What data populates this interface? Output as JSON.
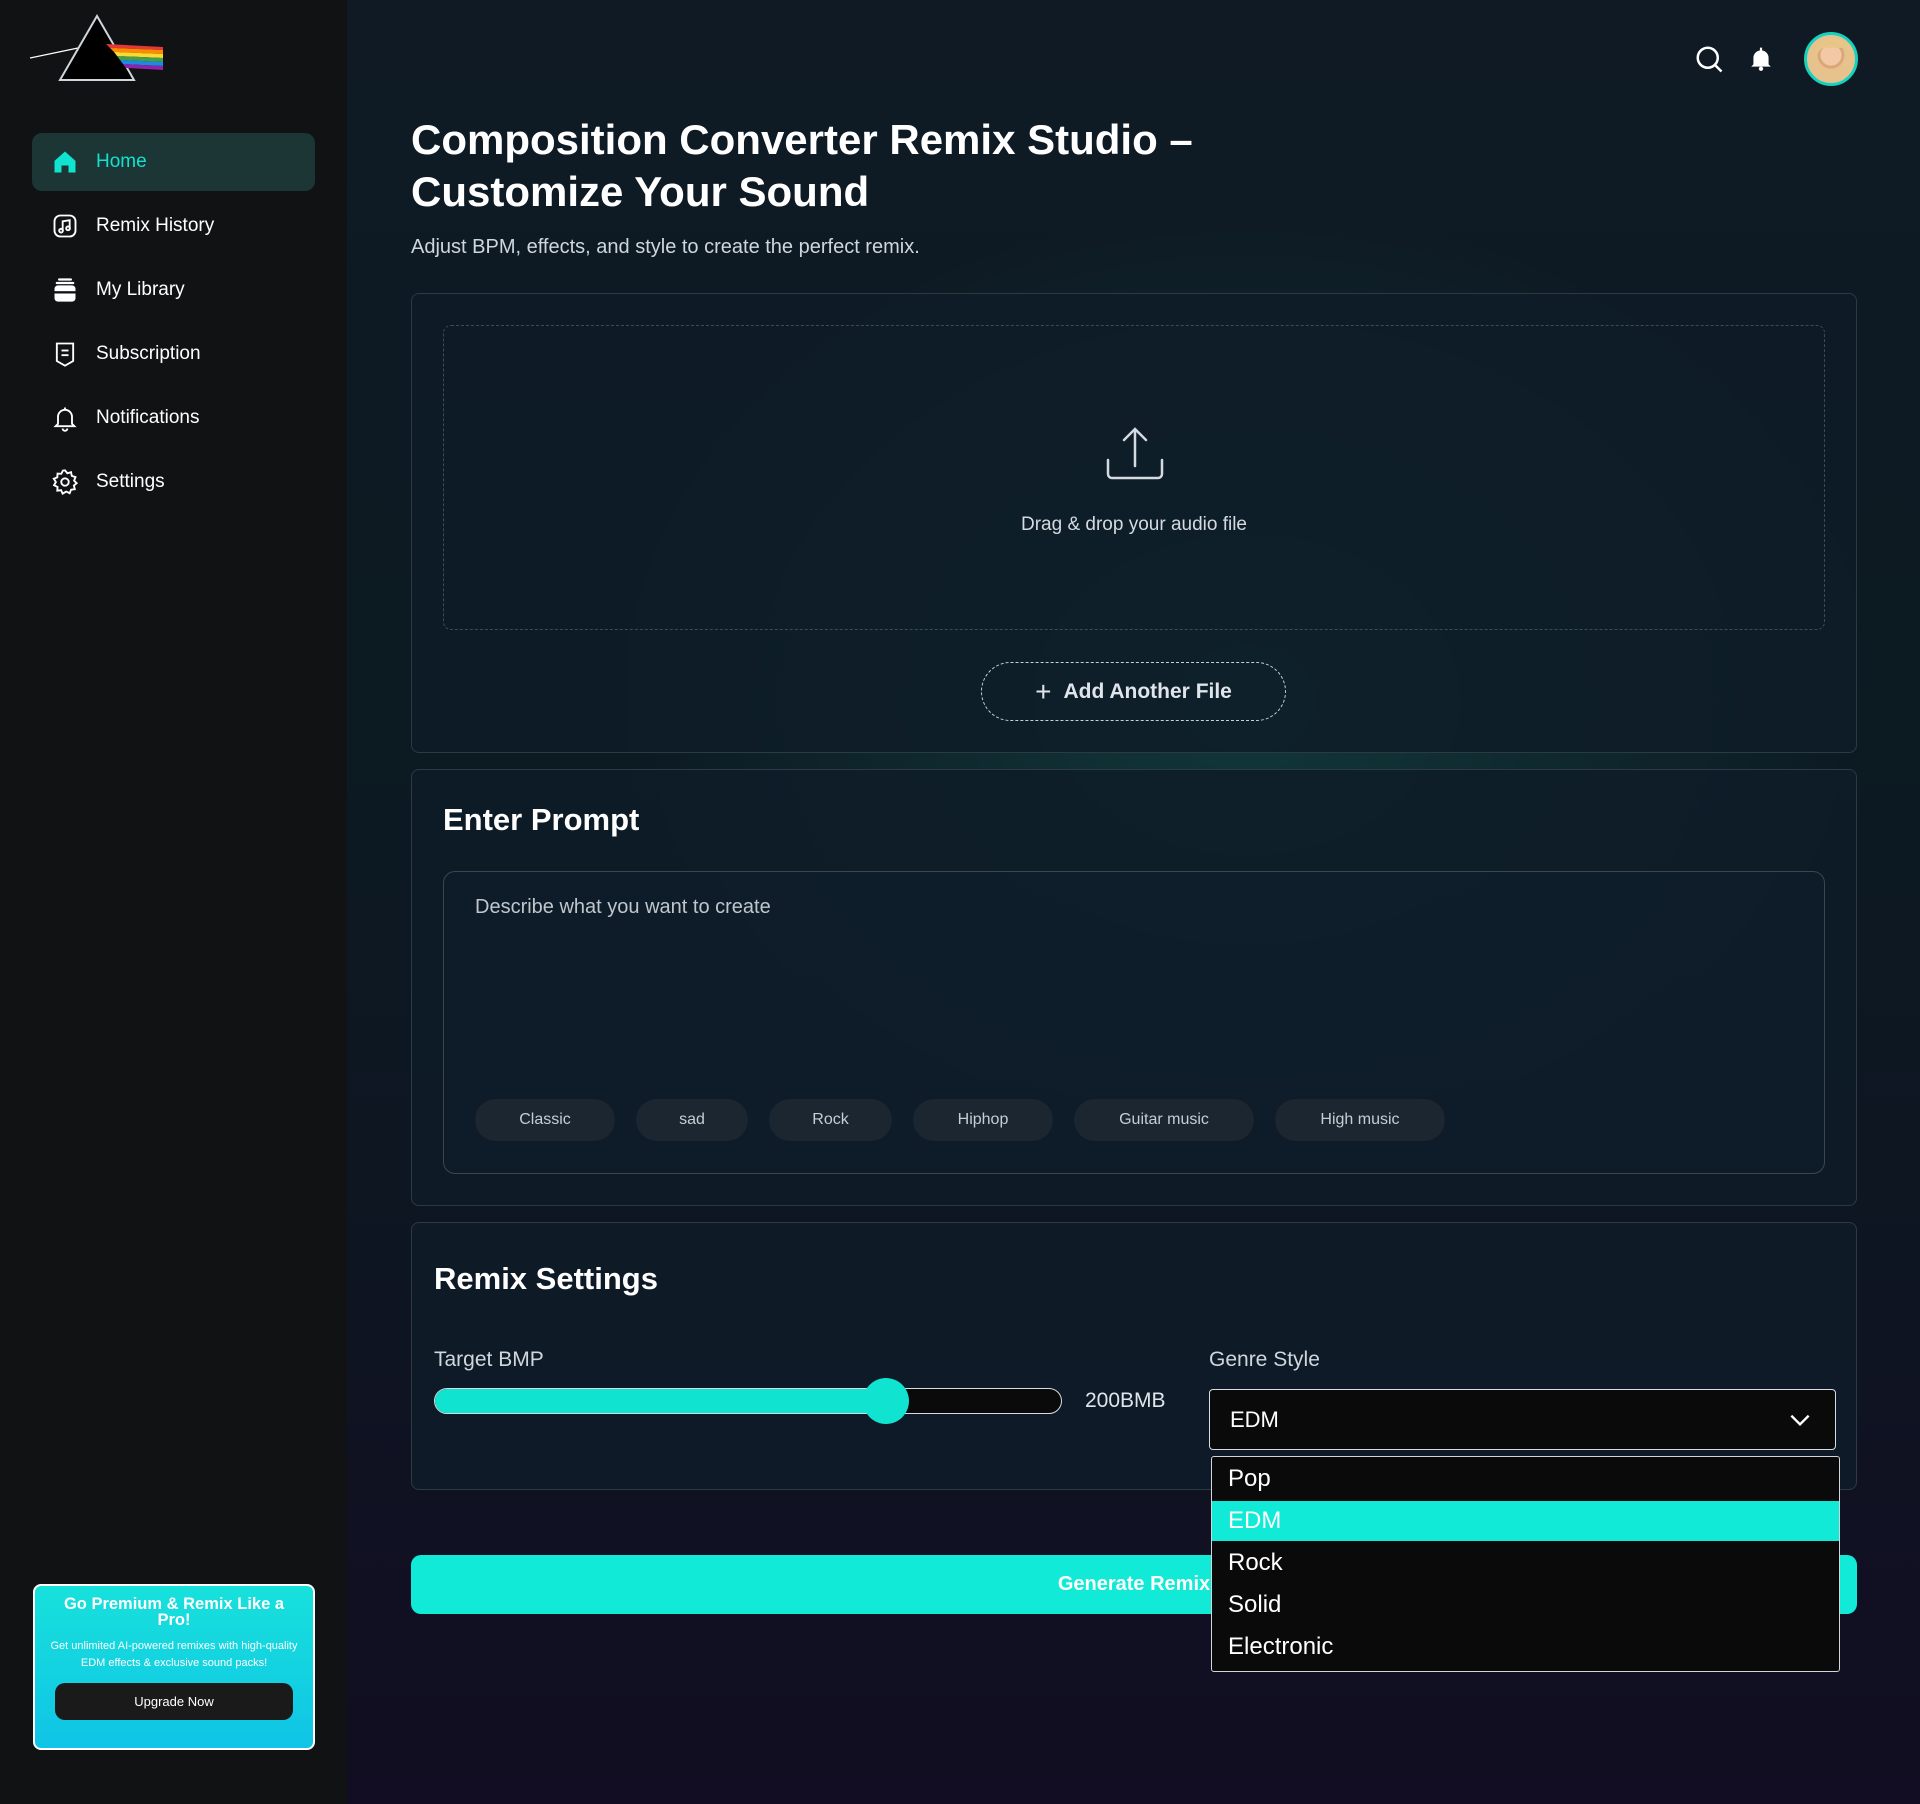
{
  "sidebar": {
    "nav": [
      {
        "label": "Home",
        "icon": "home-icon",
        "active": true
      },
      {
        "label": "Remix History",
        "icon": "music-note-icon",
        "active": false
      },
      {
        "label": "My Library",
        "icon": "library-icon",
        "active": false
      },
      {
        "label": "Subscription",
        "icon": "receipt-icon",
        "active": false
      },
      {
        "label": "Notifications",
        "icon": "bell-icon",
        "active": false
      },
      {
        "label": "Settings",
        "icon": "gear-icon",
        "active": false
      }
    ],
    "promo": {
      "title": "Go Premium & Remix Like a Pro!",
      "text": "Get unlimited AI-powered remixes with high-quality EDM effects & exclusive sound packs!",
      "button": "Upgrade Now"
    }
  },
  "header": {
    "title": "Composition Converter Remix Studio – Customize Your Sound",
    "subtitle": "Adjust BPM, effects, and style to create the perfect remix."
  },
  "upload": {
    "drop_text": "Drag & drop your audio file",
    "add_file_label": "Add Another File"
  },
  "prompt": {
    "title": "Enter Prompt",
    "placeholder": "Describe what you want to create",
    "chips": [
      "Classic",
      "sad",
      "Rock",
      "Hiphop",
      "Guitar music",
      "High music"
    ]
  },
  "settings": {
    "title": "Remix Settings",
    "bpm_label": "Target BMP",
    "bpm_value": "200BMB",
    "bpm_fill_fraction": 0.72,
    "genre_label": "Genre Style",
    "genre_selected": "EDM",
    "genre_options": [
      "Pop",
      "EDM",
      "Rock",
      "Solid",
      "Electronic"
    ]
  },
  "generate_label": "Generate Remix",
  "colors": {
    "accent": "#10e3cf",
    "sidebar_bg": "#111214",
    "active_nav_bg": "#1c3535"
  }
}
